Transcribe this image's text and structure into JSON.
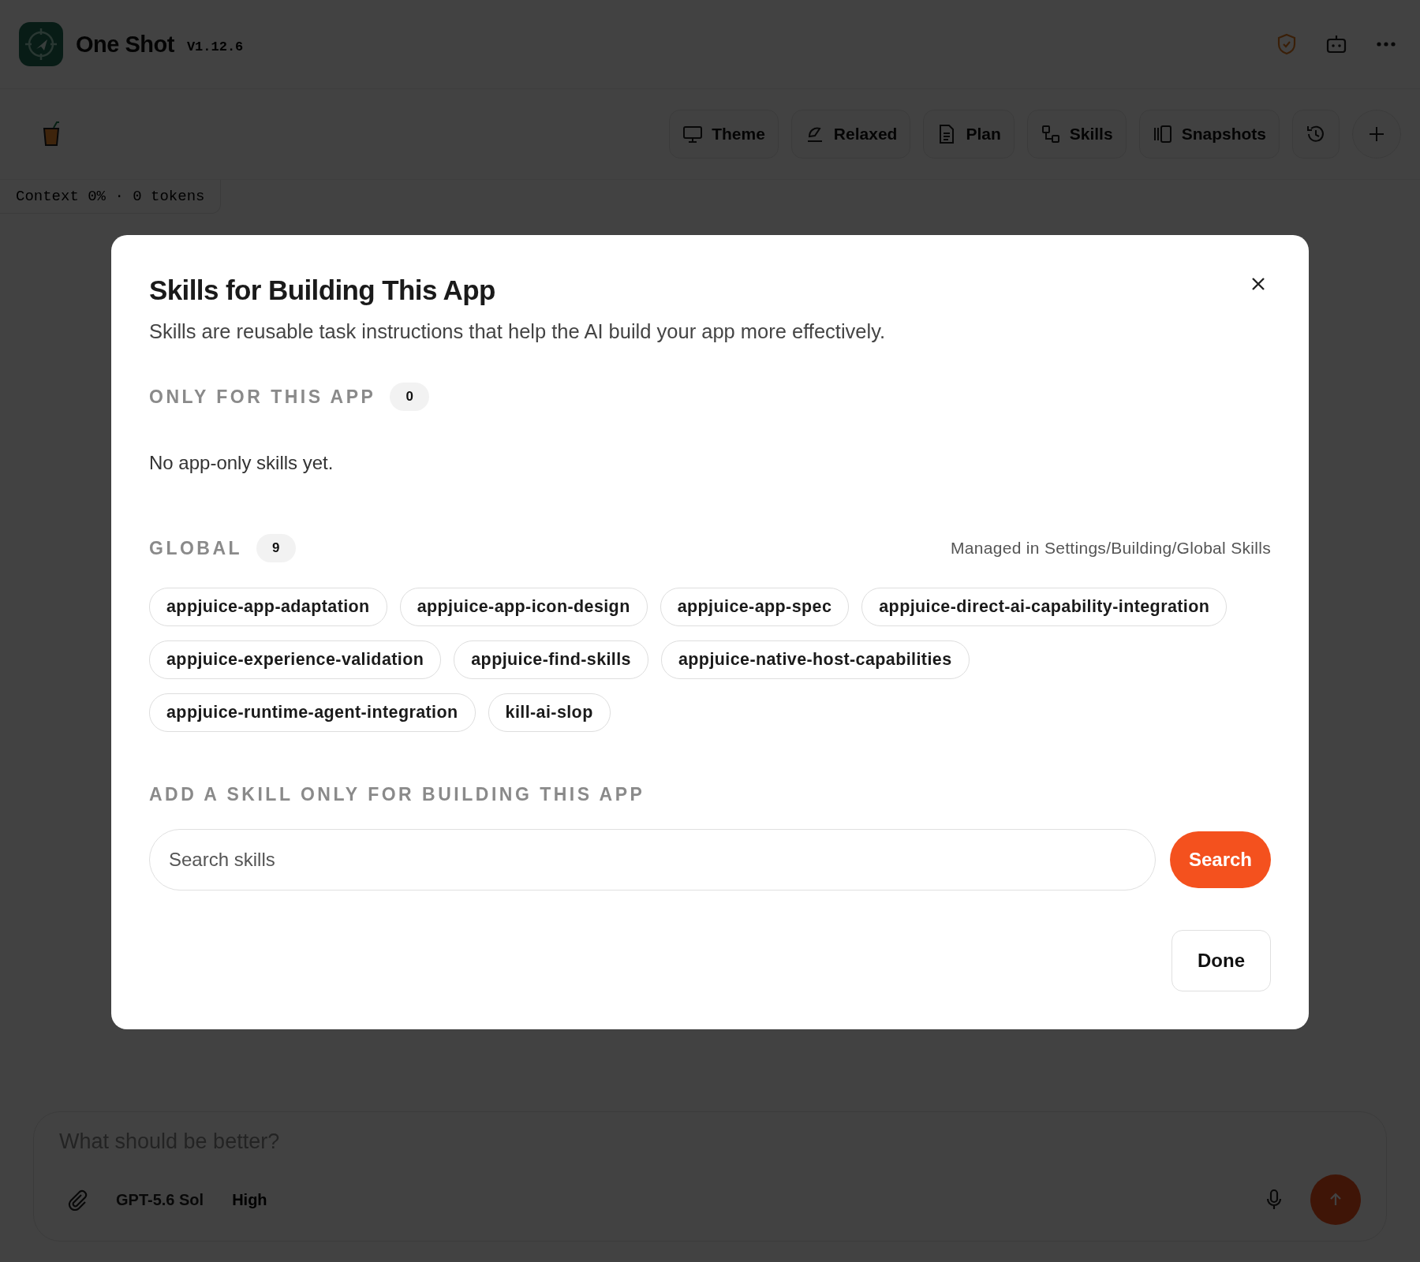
{
  "app": {
    "name": "One Shot",
    "version": "V1.12.6"
  },
  "toolbar": {
    "buttons": [
      {
        "label": "Theme"
      },
      {
        "label": "Relaxed"
      },
      {
        "label": "Plan"
      },
      {
        "label": "Skills"
      },
      {
        "label": "Snapshots"
      }
    ]
  },
  "context": "Context  0% · 0 tokens",
  "dialog": {
    "title": "Skills for Building This App",
    "description": "Skills are reusable task instructions that help the AI build your app more effectively.",
    "app_section": {
      "heading": "ONLY FOR THIS APP",
      "count": "0",
      "empty_text": "No app-only skills yet."
    },
    "global_section": {
      "heading": "GLOBAL",
      "count": "9",
      "note": "Managed in Settings/Building/Global Skills",
      "skills": [
        "appjuice-app-adaptation",
        "appjuice-app-icon-design",
        "appjuice-app-spec",
        "appjuice-direct-ai-capability-integration",
        "appjuice-experience-validation",
        "appjuice-find-skills",
        "appjuice-native-host-capabilities",
        "appjuice-runtime-agent-integration",
        "kill-ai-slop"
      ]
    },
    "add_section": {
      "heading": "ADD A SKILL ONLY FOR BUILDING THIS APP",
      "search": {
        "placeholder": "Search skills"
      },
      "search_button": "Search"
    },
    "done_button": "Done"
  },
  "composer": {
    "placeholder": "What should be better?",
    "model": "GPT-5.6 Sol",
    "effort": "High"
  }
}
